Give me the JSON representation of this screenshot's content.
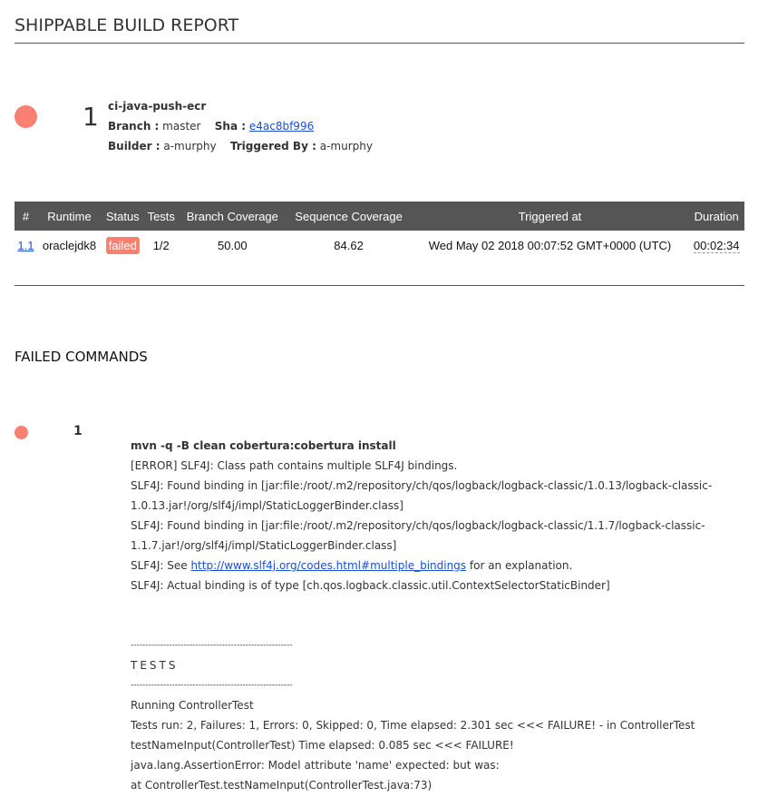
{
  "header": {
    "title": "SHIPPABLE BUILD REPORT"
  },
  "build": {
    "number": "1",
    "name": "ci-java-push-ecr",
    "branch_label": "Branch :",
    "branch": "master",
    "sha_label": "Sha :",
    "sha": "e4ac8bf996",
    "builder_label": "Builder :",
    "builder": "a-murphy",
    "triggered_label": "Triggered By :",
    "triggered_by": "a-murphy",
    "status_color": "#fa8072"
  },
  "table": {
    "headers": [
      "#",
      "Runtime",
      "Status",
      "Tests",
      "Branch Coverage",
      "Sequence Coverage",
      "Triggered at",
      "Duration"
    ],
    "rows": [
      {
        "id": "1.1",
        "runtime": "oraclejdk8",
        "status": "failed",
        "tests": "1/2",
        "branch_cov": "50.00",
        "seq_cov": "84.62",
        "triggered_at": "Wed May 02 2018 00:07:52 GMT+0000 (UTC)",
        "duration": "00:02:34"
      }
    ]
  },
  "failed": {
    "title": "FAILED COMMANDS",
    "number": "1",
    "command": "mvn -q -B clean cobertura:cobertura install",
    "lines": [
      "[ERROR] SLF4J: Class path contains multiple SLF4J bindings.",
      "SLF4J: Found binding in [jar:file:/root/.m2/repository/ch/qos/logback/logback-classic/1.0.13/logback-classic-",
      "1.0.13.jar!/org/slf4j/impl/StaticLoggerBinder.class]",
      "SLF4J: Found binding in [jar:file:/root/.m2/repository/ch/qos/logback/logback-classic/1.1.7/logback-classic-",
      "1.1.7.jar!/org/slf4j/impl/StaticLoggerBinder.class]"
    ],
    "see_prefix": "SLF4J: See ",
    "see_link": "http://www.slf4j.org/codes.html#multiple_bindings",
    "see_suffix": " for an explanation.",
    "actual": "SLF4J: Actual binding is of type [ch.qos.logback.classic.util.ContextSelectorStaticBinder]",
    "divider": "-------------------------------------------------------",
    "tests_title": "TESTS",
    "test_lines": [
      "Running ControllerTest",
      "Tests run: 2, Failures: 1, Errors: 0, Skipped: 0, Time elapsed: 2.301 sec <<< FAILURE! - in ControllerTest",
      "testNameInput(ControllerTest) Time elapsed: 0.085 sec <<< FAILURE!",
      "java.lang.AssertionError: Model attribute 'name' expected: but was:",
      "at ControllerTest.testNameInput(ControllerTest.java:73)"
    ]
  }
}
